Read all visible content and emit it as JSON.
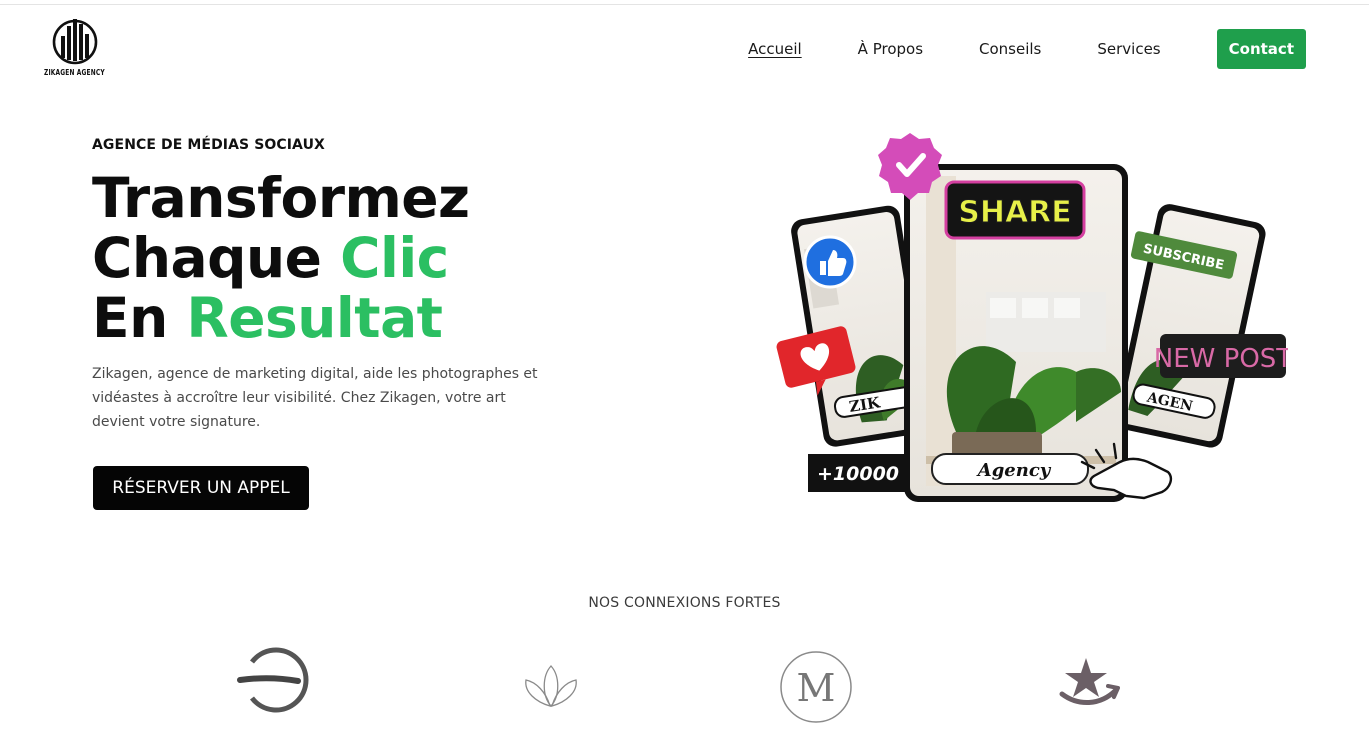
{
  "header": {
    "logo_text": "ZIKAGEN AGENCY",
    "nav": [
      {
        "label": "Accueil",
        "active": true
      },
      {
        "label": "À Propos"
      },
      {
        "label": "Conseils"
      },
      {
        "label": "Services"
      }
    ],
    "cta_label": "Contact"
  },
  "hero": {
    "eyebrow": "AGENCE DE MÉDIAS SOCIAUX",
    "headline": {
      "line1": "Transformez",
      "line2a": "Chaque ",
      "line2b": "Clic",
      "line3a": "En ",
      "line3b": "Resultat"
    },
    "description": "Zikagen, agence de marketing digital, aide les photographes et vidéastes à accroître leur visibilité. Chez Zikagen, votre art devient votre signature.",
    "button_label": "RÉSERVER UN APPEL",
    "art": {
      "share": "SHARE",
      "subscribe": "SUBSCRIBE",
      "new_post": "NEW POST",
      "agency": "Agency",
      "left_tag": "ZIK",
      "right_tag": "AGEN",
      "followers": "+10000"
    }
  },
  "partners": {
    "title": "NOS CONNEXIONS FORTES",
    "logo_letter": "M"
  },
  "colors": {
    "accent_green": "#2bbf62",
    "cta_green": "#1f9f4c",
    "dark_button": "#050505"
  }
}
